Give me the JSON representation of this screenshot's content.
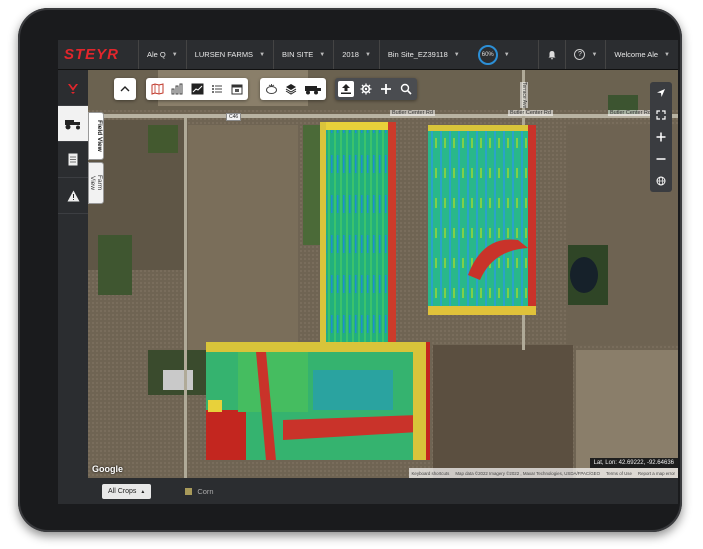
{
  "app": {
    "logo": "STEYR"
  },
  "topbar": {
    "dropdowns": [
      {
        "label": "Ale Q"
      },
      {
        "label": "LURSEN FARMS"
      },
      {
        "label": "BIN SITE"
      },
      {
        "label": "2018"
      },
      {
        "label": "Bin Site_EZ39118"
      }
    ],
    "zoom": "60%",
    "help_label": "?",
    "welcome": "Welcome Ale"
  },
  "sidebar": {
    "items": [
      {
        "icon": "steyr-logo-icon"
      },
      {
        "icon": "tractor-icon"
      },
      {
        "icon": "document-icon"
      },
      {
        "icon": "warning-icon"
      }
    ]
  },
  "view_tabs": {
    "field_view": "Field View",
    "farm_view": "Farm View"
  },
  "map": {
    "road_labels": [
      {
        "text": "Butler Center Rd"
      },
      {
        "text": "Butler Center Rd"
      },
      {
        "text": "Butler Center Rd"
      },
      {
        "text": "Terrace Ave"
      },
      {
        "text": "C46"
      }
    ],
    "coordinates": "Lat, Lon: 42.69222, -92.64636",
    "attribution": {
      "shortcuts": "Keyboard shortcuts",
      "data": "Map data ©2022 Imagery ©2022 , Maxar Technologies, USDA/FPAC/GEO",
      "terms": "Terms of Use",
      "report": "Report a map error"
    },
    "google_logo": "Google"
  },
  "bottombar": {
    "crops_button": "All Crops",
    "legend_label": "Corn",
    "legend_color": "#a89a5a"
  },
  "colors": {
    "brand_red": "#e2262c",
    "accent_blue": "#2c8fd6"
  }
}
